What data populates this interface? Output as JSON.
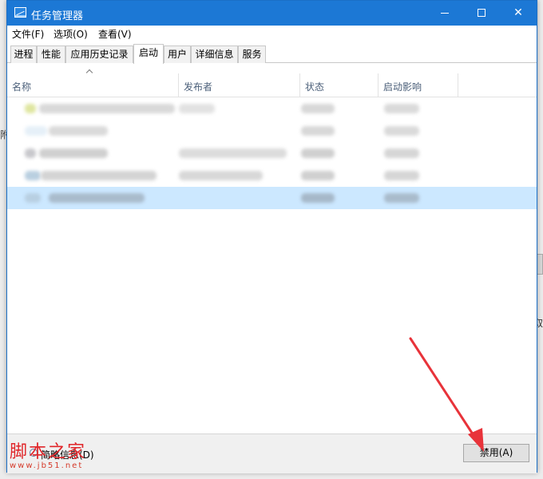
{
  "window": {
    "title": "任务管理器"
  },
  "menu": {
    "items": [
      {
        "label": "文件(F)"
      },
      {
        "label": "选项(O)"
      },
      {
        "label": "查看(V)"
      }
    ]
  },
  "tabs": [
    {
      "label": "进程",
      "active": false
    },
    {
      "label": "性能",
      "active": false
    },
    {
      "label": "应用历史记录",
      "active": false
    },
    {
      "label": "启动",
      "active": true
    },
    {
      "label": "用户",
      "active": false
    },
    {
      "label": "详细信息",
      "active": false
    },
    {
      "label": "服务",
      "active": false
    }
  ],
  "columns": {
    "name": "名称",
    "publisher": "发布者",
    "status": "状态",
    "impact": "启动影响"
  },
  "rows": [
    {
      "selected": false
    },
    {
      "selected": false
    },
    {
      "selected": false
    },
    {
      "selected": false
    },
    {
      "selected": true
    }
  ],
  "footer": {
    "link_label": "简略信息(D)",
    "disable_button": "禁用(A)"
  },
  "watermark": {
    "main": "脚本之家",
    "sub": "www.jb51.net"
  },
  "background": {
    "left_char": "附",
    "right_char": "取"
  },
  "colors": {
    "titlebar": "#1c78d5",
    "selected_row": "#cce8ff",
    "arrow": "#e8333a",
    "watermark": "#e0262a"
  }
}
